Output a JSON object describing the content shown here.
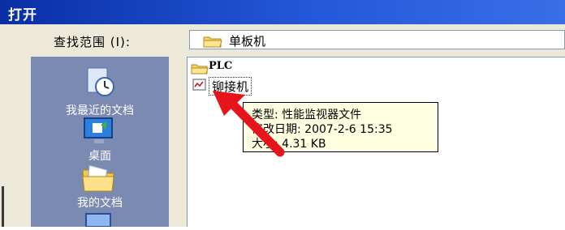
{
  "window": {
    "title": "打开"
  },
  "lookin": {
    "label": "查找范围 (I):",
    "value": "单板机",
    "icon": "folder-icon"
  },
  "places": [
    {
      "label": "我最近的文档",
      "icon": "recent-documents-icon"
    },
    {
      "label": "桌面",
      "icon": "desktop-icon"
    },
    {
      "label": "我的文档",
      "icon": "my-documents-icon"
    },
    {
      "label": "",
      "icon": "my-computer-icon"
    }
  ],
  "files": [
    {
      "name": "PLC",
      "icon": "folder-icon"
    },
    {
      "name": "铆接机",
      "icon": "performance-monitor-file-icon"
    }
  ],
  "tooltip": {
    "type": "类型:  性能监视器文件",
    "modified": "修改日期: 2007-2-6 15:35",
    "size": "大小:  4.31 KB"
  },
  "annotation": {
    "icon": "red-arrow-icon",
    "color": "#e8141c"
  },
  "colors": {
    "titlebar": "#0a2fa6",
    "places_bar": "#7b8ab0",
    "dialog_bg": "#ece9d8",
    "tooltip_bg": "#ffffe1"
  }
}
